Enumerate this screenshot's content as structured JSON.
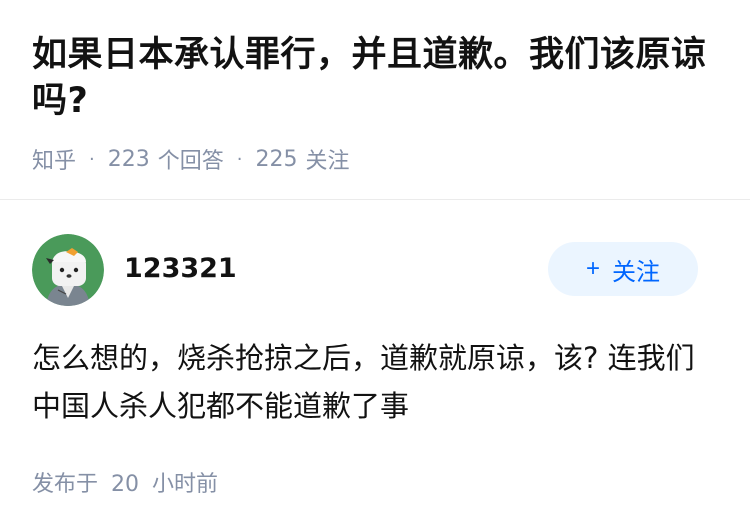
{
  "question": {
    "title": "如果日本承认罪行，并且道歉。我们该原谅吗?",
    "source": "知乎",
    "answer_count": "223",
    "answer_label": "个回答",
    "follower_count": "225",
    "follower_label": "关注"
  },
  "answer": {
    "author_name": "123321",
    "follow_label": "关注",
    "follow_icon": "plus-icon",
    "content": "怎么想的，烧杀抢掠之后，道歉就原谅，该? 连我们中国人杀人犯都不能道歉了事",
    "published_prefix": "发布于",
    "published_number": "20",
    "published_unit": "小时前"
  },
  "colors": {
    "title": "#121212",
    "meta": "#8590a6",
    "accent": "#0066ff",
    "follow_bg": "#ebf5ff",
    "avatar_bg": "#4a9a5a",
    "divider": "#ebebeb"
  }
}
